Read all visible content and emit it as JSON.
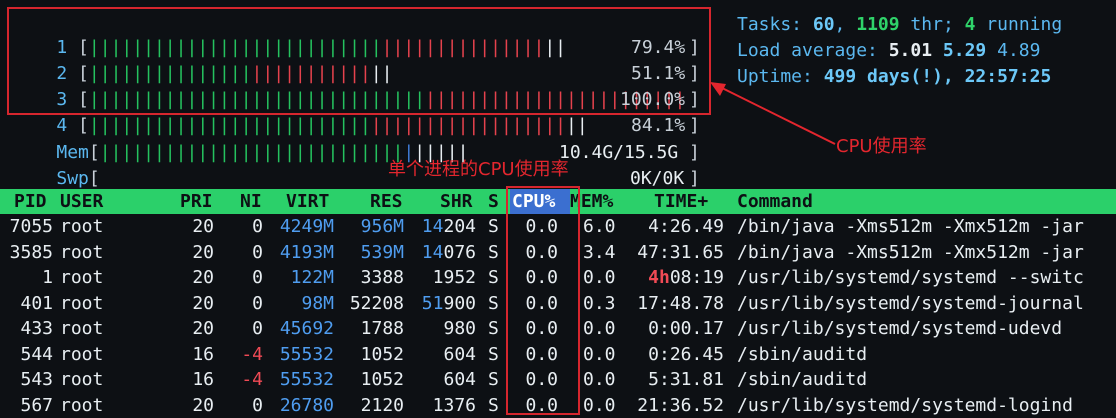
{
  "meters": {
    "cpus": [
      {
        "label": "1",
        "percent_text": "79.4%",
        "usage": 0.794
      },
      {
        "label": "2",
        "percent_text": "51.1%",
        "usage": 0.511
      },
      {
        "label": "3",
        "percent_text": "100.0%",
        "usage": 1.0
      },
      {
        "label": "4",
        "percent_text": "84.1%",
        "usage": 0.841
      }
    ],
    "mem": {
      "label": "Mem",
      "value_text": "10.4G/15.5G",
      "usage": 0.671
    },
    "swp": {
      "label": "Swp",
      "value_text": "0K/0K",
      "usage": 0.0
    }
  },
  "summary": {
    "tasks_label": "Tasks: ",
    "tasks_count": "60",
    "tasks_sep": ", ",
    "threads_count": "1109",
    "threads_suffix": " thr; ",
    "running_count": "4",
    "running_suffix": " running",
    "load_label": "Load average: ",
    "load_1": "5.01",
    "load_5": "5.29",
    "load_15": "4.89",
    "uptime_label": "Uptime: ",
    "uptime_value": "499 days(!), 22:57:25"
  },
  "annotations": {
    "cpu_usage_label": "CPU使用率",
    "process_cpu_label": "单个进程的CPU使用率"
  },
  "table": {
    "columns": [
      "PID",
      "USER",
      "PRI",
      "NI",
      "VIRT",
      "RES",
      "SHR",
      "S",
      "CPU%",
      "MEM%",
      "TIME+",
      "Command"
    ],
    "rows": [
      {
        "pid": "7055",
        "user": "root",
        "pri": "20",
        "ni": "0",
        "virt": "4249M",
        "res": "956M",
        "shr": "14204",
        "s": "S",
        "cpu": "0.0",
        "mem": "6.0",
        "time_hi": "",
        "time": "4:26.49",
        "cmd": "/bin/java -Xms512m -Xmx512m -jar"
      },
      {
        "pid": "3585",
        "user": "root",
        "pri": "20",
        "ni": "0",
        "virt": "4193M",
        "res": "539M",
        "shr": "14076",
        "s": "S",
        "cpu": "0.0",
        "mem": "3.4",
        "time_hi": "",
        "time": "47:31.65",
        "cmd": "/bin/java -Xms512m -Xmx512m -jar"
      },
      {
        "pid": "1",
        "user": "root",
        "pri": "20",
        "ni": "0",
        "virt": "122M",
        "res": "3388",
        "shr": "1952",
        "s": "S",
        "cpu": "0.0",
        "mem": "0.0",
        "time_hi": "4h",
        "time": "08:19",
        "cmd": "/usr/lib/systemd/systemd --switc"
      },
      {
        "pid": "401",
        "user": "root",
        "pri": "20",
        "ni": "0",
        "virt": "98M",
        "res": "52208",
        "shr": "51900",
        "s": "S",
        "cpu": "0.0",
        "mem": "0.3",
        "time_hi": "",
        "time": "17:48.78",
        "cmd": "/usr/lib/systemd/systemd-journal"
      },
      {
        "pid": "433",
        "user": "root",
        "pri": "20",
        "ni": "0",
        "virt": "45692",
        "res": "1788",
        "shr": "980",
        "s": "S",
        "cpu": "0.0",
        "mem": "0.0",
        "time_hi": "",
        "time": "0:00.17",
        "cmd": "/usr/lib/systemd/systemd-udevd"
      },
      {
        "pid": "544",
        "user": "root",
        "pri": "16",
        "ni": "-4",
        "virt": "55532",
        "res": "1052",
        "shr": "604",
        "s": "S",
        "cpu": "0.0",
        "mem": "0.0",
        "time_hi": "",
        "time": "0:26.45",
        "cmd": "/sbin/auditd"
      },
      {
        "pid": "543",
        "user": "root",
        "pri": "16",
        "ni": "-4",
        "virt": "55532",
        "res": "1052",
        "shr": "604",
        "s": "S",
        "cpu": "0.0",
        "mem": "0.0",
        "time_hi": "",
        "time": "5:31.81",
        "cmd": "/sbin/auditd"
      },
      {
        "pid": "567",
        "user": "root",
        "pri": "20",
        "ni": "0",
        "virt": "26780",
        "res": "2120",
        "shr": "1376",
        "s": "S",
        "cpu": "0.0",
        "mem": "0.0",
        "time_hi": "",
        "time": "21:36.52",
        "cmd": "/usr/lib/systemd/systemd-logind"
      }
    ]
  },
  "colors": {
    "background": "#0d1014",
    "header_bar": "#2bd06a",
    "sorted_column": "#3b6fd0",
    "annotation": "#e3262e",
    "meter_user": "#25c25f",
    "meter_system": "#e5424d"
  }
}
